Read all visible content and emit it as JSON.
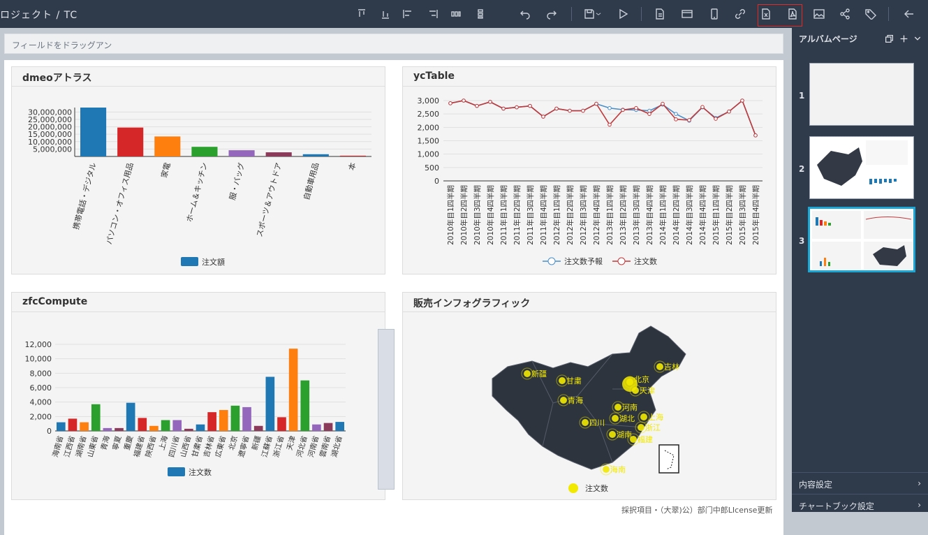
{
  "header": {
    "breadcrumb": "ロジェクト / TC"
  },
  "toolbar": {
    "icons": [
      "align-top-icon",
      "align-bottom-icon",
      "align-left-icon",
      "align-right-icon",
      "distribute-horizontal-icon",
      "distribute-vertical-icon",
      "undo-icon",
      "redo-icon",
      "save-icon",
      "play-icon",
      "document-icon",
      "card-icon",
      "mobile-icon",
      "link-icon",
      "export-excel-icon",
      "export-pdf-icon",
      "image-icon",
      "share-icon",
      "tag-icon",
      "back-icon"
    ]
  },
  "dragbar": {
    "placeholder": "フィールドをドラッグアン"
  },
  "panels": {
    "p1": {
      "title": "dmeoアトラス",
      "legend": "注文額"
    },
    "p2": {
      "title": "ycTable",
      "legend1": "注文数予報",
      "legend2": "注文数"
    },
    "p3": {
      "title": "zfcCompute",
      "legend": "注文数"
    },
    "p4": {
      "title": "販売インフォグラフィック",
      "legend": "注文数"
    }
  },
  "chart_data": [
    {
      "type": "bar",
      "title": "dmeoアトラス",
      "categories": [
        "携帯電話・デジタル",
        "パソコン・オフィス用品",
        "家電",
        "ホーム＆キッチン",
        "服・バッグ",
        "スポーツ＆アウトドア",
        "自動車用品",
        "本"
      ],
      "values": [
        33000000,
        19500000,
        13500000,
        6500000,
        4200000,
        2800000,
        1500000,
        500000
      ],
      "colors": [
        "#1f77b4",
        "#d62728",
        "#ff7f0e",
        "#2ca02c",
        "#9467bd",
        "#8c3a5a",
        "#1f77b4",
        "#d62728"
      ],
      "yticks": [
        "5,000,000",
        "10,000,000",
        "15,000,000",
        "20,000,000",
        "25,000,000",
        "30,000,000"
      ],
      "ylim": [
        0,
        33000000
      ],
      "legend": [
        "注文額"
      ]
    },
    {
      "type": "line",
      "title": "ycTable",
      "categories": [
        "2010年目1四半期",
        "2010年目2四半期",
        "2010年目3四半期",
        "2010年目4四半期",
        "2011年目1四半期",
        "2011年目2四半期",
        "2011年目3四半期",
        "2011年目4四半期",
        "2012年目1四半期",
        "2012年目2四半期",
        "2012年目3四半期",
        "2012年目4四半期",
        "2013年目1四半期",
        "2013年目2四半期",
        "2013年目3四半期",
        "2013年目4四半期",
        "2014年目1四半期",
        "2014年目2四半期",
        "2014年目3四半期",
        "2014年目4四半期",
        "2015年目1四半期",
        "2015年目2四半期",
        "2015年目3四半期",
        "2015年目4四半期"
      ],
      "series": [
        {
          "name": "注文数予報",
          "color": "#4a8fc7",
          "values": [
            2900,
            3000,
            2800,
            2950,
            2700,
            2750,
            2800,
            2400,
            2700,
            2620,
            2620,
            2880,
            2720,
            2660,
            2650,
            2620,
            2850,
            2500,
            2250,
            2750,
            2350,
            2590,
            3000,
            1700
          ]
        },
        {
          "name": "注文数",
          "color": "#c0393b",
          "values": [
            2900,
            3000,
            2800,
            2950,
            2700,
            2750,
            2800,
            2400,
            2700,
            2620,
            2620,
            2880,
            2100,
            2650,
            2720,
            2500,
            2880,
            2300,
            2270,
            2760,
            2320,
            2590,
            3000,
            1700
          ]
        }
      ],
      "yticks": [
        "0",
        "500",
        "1,000",
        "1,500",
        "2,000",
        "2,500",
        "3,000"
      ],
      "ylim": [
        0,
        3000
      ]
    },
    {
      "type": "bar",
      "title": "zfcCompute",
      "categories": [
        "海南省",
        "江西省",
        "湖南省",
        "山東省",
        "青海",
        "寧夏",
        "重慶",
        "福建省",
        "陝西省",
        "上海",
        "四川省",
        "山西省",
        "甘粛省",
        "吉林省",
        "広東省",
        "北京",
        "遼寧省",
        "新疆",
        "江蘇省",
        "浙江省",
        "天津",
        "河北省",
        "河南省",
        "雲南省",
        "湖北省"
      ],
      "values": [
        1200,
        1700,
        1200,
        3700,
        400,
        400,
        3900,
        1800,
        700,
        1500,
        1500,
        300,
        900,
        2600,
        2900,
        3500,
        3300,
        700,
        7500,
        1900,
        11400,
        7000,
        900,
        1100,
        1250
      ],
      "colors": [
        "#1f77b4",
        "#d62728",
        "#ff7f0e",
        "#2ca02c",
        "#9467bd",
        "#8c3a5a",
        "#1f77b4",
        "#d62728",
        "#ff7f0e",
        "#2ca02c",
        "#9467bd",
        "#8c3a5a",
        "#1f77b4",
        "#d62728",
        "#ff7f0e",
        "#2ca02c",
        "#9467bd",
        "#8c3a5a",
        "#1f77b4",
        "#d62728",
        "#ff7f0e",
        "#2ca02c",
        "#9467bd",
        "#8c3a5a",
        "#1f77b4"
      ],
      "yticks": [
        "0",
        "2,000",
        "4,000",
        "6,000",
        "8,000",
        "10,000",
        "12,000"
      ],
      "ylim": [
        0,
        12000
      ],
      "legend": [
        "注文数"
      ]
    }
  ],
  "map": {
    "labels": [
      "新疆",
      "甘粛",
      "青海",
      "吉林",
      "北京",
      "天津",
      "河南",
      "湖北",
      "上海",
      "四川",
      "湖南",
      "浙江",
      "福建",
      "海南"
    ]
  },
  "sidebar": {
    "title": "アルバムページ",
    "pages": [
      "1",
      "2",
      "3"
    ],
    "content_settings": "内容設定",
    "chartbook_settings": "チャートブック設定"
  },
  "footer": {
    "text": "採択項目・（大翠)公）部门中郎LIcense更新"
  }
}
